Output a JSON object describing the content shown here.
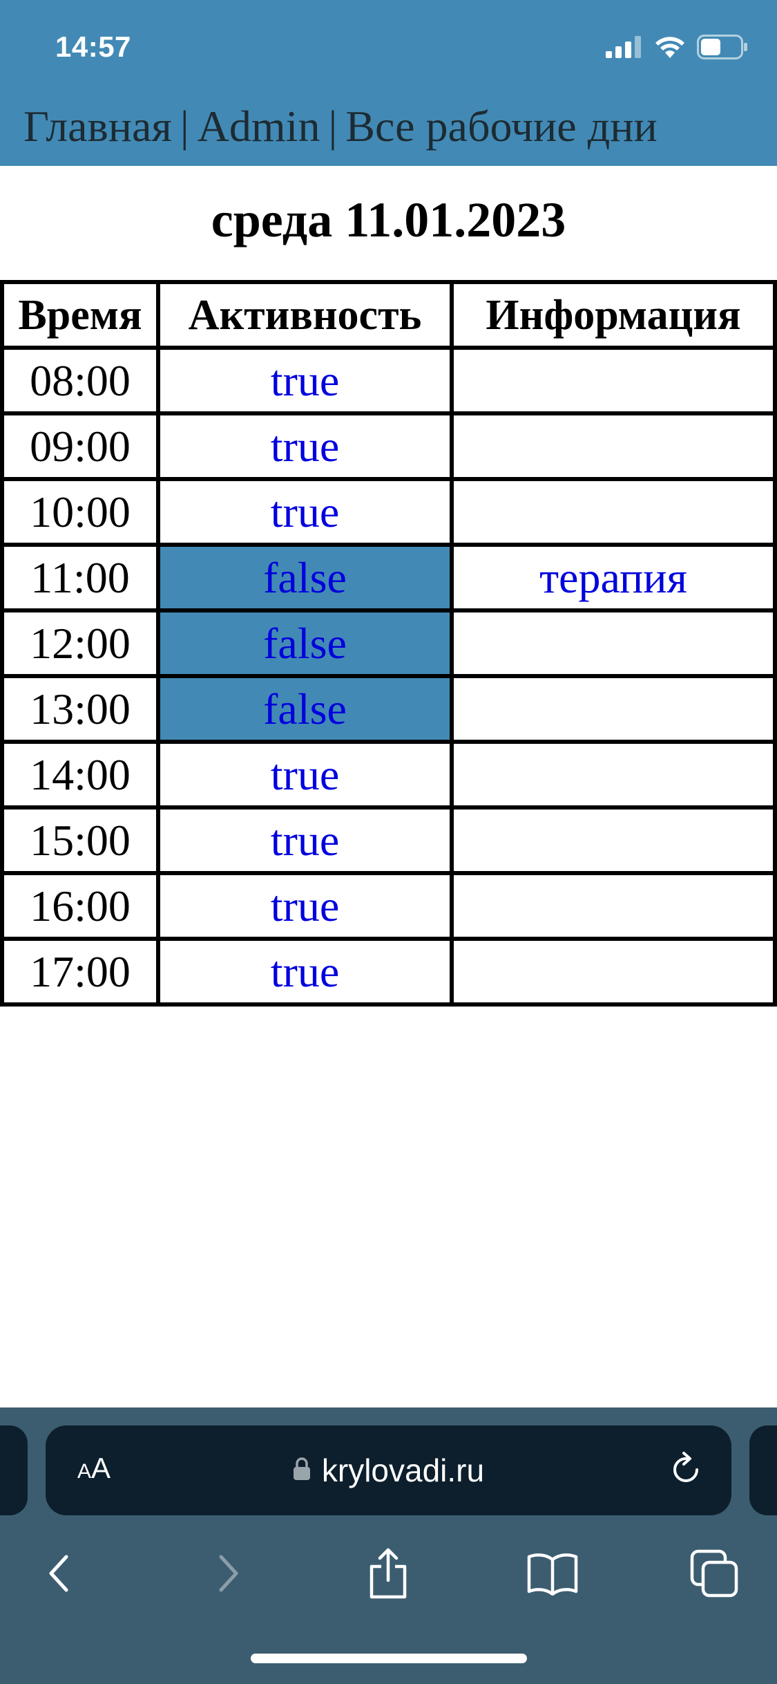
{
  "status_bar": {
    "time": "14:57",
    "icons": [
      "signal-icon",
      "wifi-icon",
      "battery-icon"
    ]
  },
  "nav": {
    "home": "Главная",
    "admin": "Admin",
    "workdays": "Все рабочие дни",
    "separator": "|"
  },
  "page": {
    "title": "среда 11.01.2023"
  },
  "table": {
    "headers": {
      "time": "Время",
      "activity": "Активность",
      "info": "Информация"
    },
    "rows": [
      {
        "time": "08:00",
        "activity": "true",
        "info": ""
      },
      {
        "time": "09:00",
        "activity": "true",
        "info": ""
      },
      {
        "time": "10:00",
        "activity": "true",
        "info": ""
      },
      {
        "time": "11:00",
        "activity": "false",
        "info": "терапия"
      },
      {
        "time": "12:00",
        "activity": "false",
        "info": ""
      },
      {
        "time": "13:00",
        "activity": "false",
        "info": ""
      },
      {
        "time": "14:00",
        "activity": "true",
        "info": ""
      },
      {
        "time": "15:00",
        "activity": "true",
        "info": ""
      },
      {
        "time": "16:00",
        "activity": "true",
        "info": ""
      },
      {
        "time": "17:00",
        "activity": "true",
        "info": ""
      }
    ]
  },
  "browser": {
    "aa_small": "A",
    "aa_big": "A",
    "url": "krylovadi.ru",
    "icons": [
      "lock-icon",
      "reload-icon",
      "back-icon",
      "forward-icon",
      "share-icon",
      "bookmarks-icon",
      "tabs-icon"
    ]
  },
  "colors": {
    "header_bg": "#428ab5",
    "inactive_cell_bg": "#428ab5",
    "link_blue": "#0000dd",
    "nav_text": "#1d2b33",
    "browser_bar_bg": "#3c5d70",
    "address_bar_bg": "#0d1f2d"
  }
}
